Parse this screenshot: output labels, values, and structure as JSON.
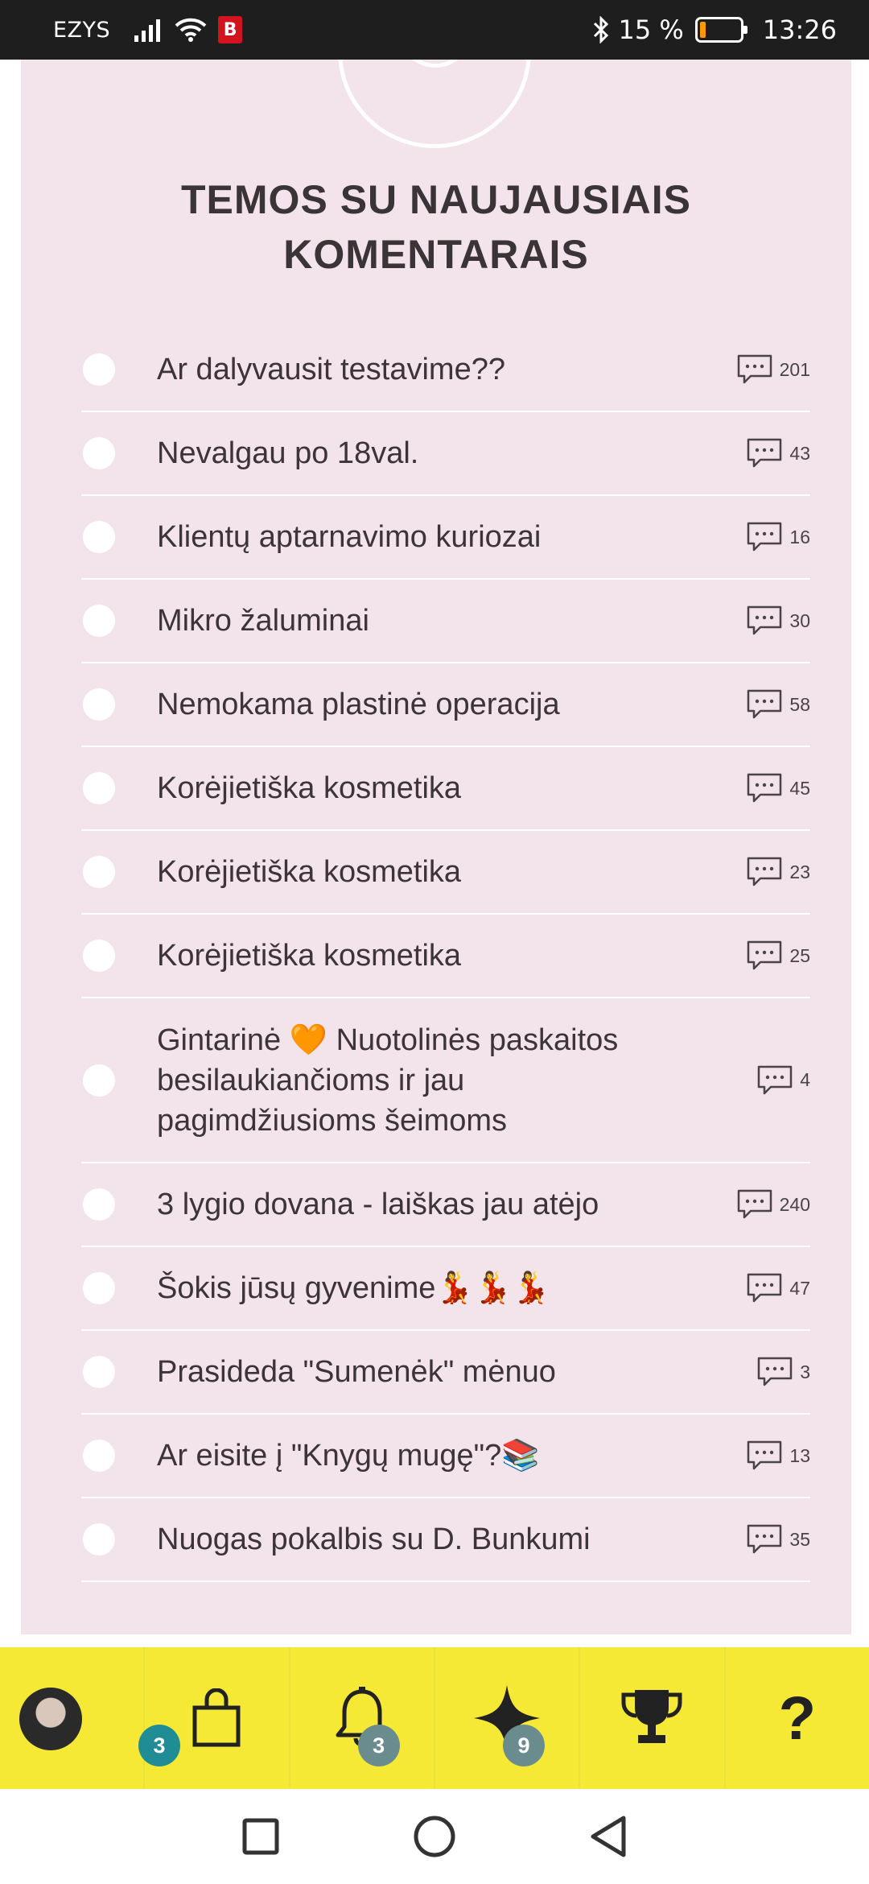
{
  "status_bar": {
    "carrier": "EZYS",
    "app_badge": "B",
    "battery_text": "15 %",
    "battery_level": 0.15,
    "time": "13:26"
  },
  "section": {
    "title_line1": "TEMOS SU NAUJAUSIAIS",
    "title_line2": "KOMENTARAIS"
  },
  "topics": [
    {
      "title": "Ar dalyvausit testavime??",
      "count": "201"
    },
    {
      "title": "Nevalgau po 18val.",
      "count": "43"
    },
    {
      "title": "Klientų aptarnavimo kuriozai",
      "count": "16"
    },
    {
      "title": "Mikro žaluminai",
      "count": "30"
    },
    {
      "title": "Nemokama plastinė operacija",
      "count": "58"
    },
    {
      "title": "Korėjietiška kosmetika",
      "count": "45"
    },
    {
      "title": "Korėjietiška kosmetika",
      "count": "23"
    },
    {
      "title": "Korėjietiška kosmetika",
      "count": "25"
    },
    {
      "title": "Gintarinė 🧡 Nuotolinės paskaitos besilaukiančioms ir jau pagimdžiusioms šeimoms",
      "count": "4"
    },
    {
      "title": "3 lygio dovana - laiškas jau atėjo",
      "count": "240"
    },
    {
      "title": "Šokis jūsų gyvenime💃💃💃",
      "count": "47"
    },
    {
      "title": "Prasideda \"Sumenėk\" mėnuo",
      "count": "3"
    },
    {
      "title": "Ar eisite į \"Knygų mugę\"?📚",
      "count": "13"
    },
    {
      "title": "Nuogas pokalbis su D. Bunkumi",
      "count": "35"
    }
  ],
  "bottom_nav": {
    "profile_badge": "3",
    "notifications_badge": "3",
    "stars_badge": "9",
    "help_label": "?"
  },
  "icons": {
    "comments": "speech-bubble-dots-icon",
    "shop": "shopping-bag-icon",
    "notifications": "bell-icon",
    "stars": "sparkle-star-icon",
    "rewards": "trophy-icon",
    "help": "question-mark-icon"
  },
  "colors": {
    "panel_bg": "#f3e3eb",
    "nav_bg": "#f5e936",
    "badge_teal": "#1f8c96",
    "badge_grey": "#6a8c8f",
    "text": "#3c3438"
  }
}
